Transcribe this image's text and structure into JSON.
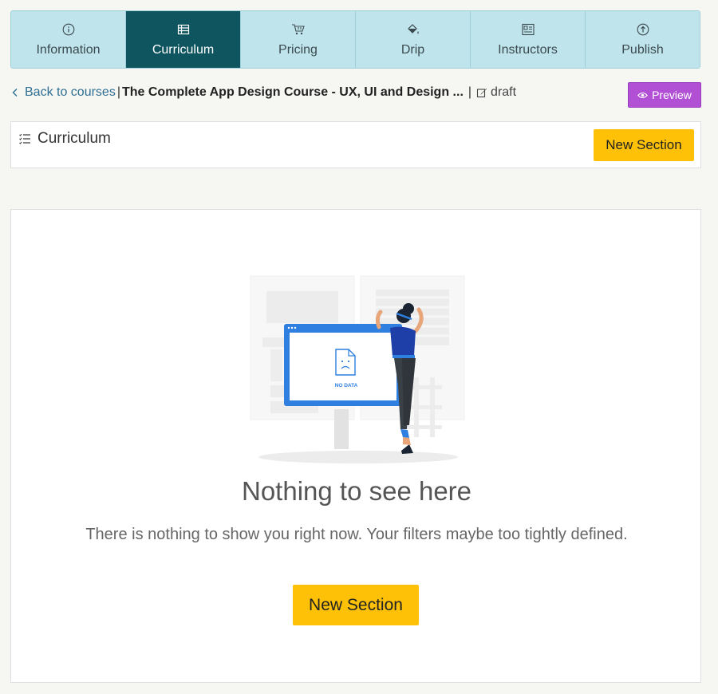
{
  "tabs": [
    {
      "label": "Information",
      "icon": "info-icon",
      "active": false
    },
    {
      "label": "Curriculum",
      "icon": "table-icon",
      "active": true
    },
    {
      "label": "Pricing",
      "icon": "cart-icon",
      "active": false
    },
    {
      "label": "Drip",
      "icon": "paint-bucket-icon",
      "active": false
    },
    {
      "label": "Instructors",
      "icon": "id-card-icon",
      "active": false
    },
    {
      "label": "Publish",
      "icon": "upload-icon",
      "active": false
    }
  ],
  "breadcrumb": {
    "back_label": "Back to courses",
    "separator": "|",
    "course_title": "The Complete App Design Course - UX, UI and Design ...",
    "status": "draft"
  },
  "preview_label": "Preview",
  "curriculum": {
    "title": "Curriculum",
    "new_section_label": "New Section"
  },
  "empty_state": {
    "illustration_text": "NO DATA",
    "title": "Nothing to see here",
    "description": "There is nothing to show you right now. Your filters maybe too tightly defined.",
    "button_label": "New Section"
  },
  "colors": {
    "tab_bg": "#bfe4eb",
    "tab_active": "#0f5560",
    "accent_yellow": "#ffc107",
    "preview_purple": "#b150d4",
    "illustration_blue": "#2f7fe0"
  }
}
